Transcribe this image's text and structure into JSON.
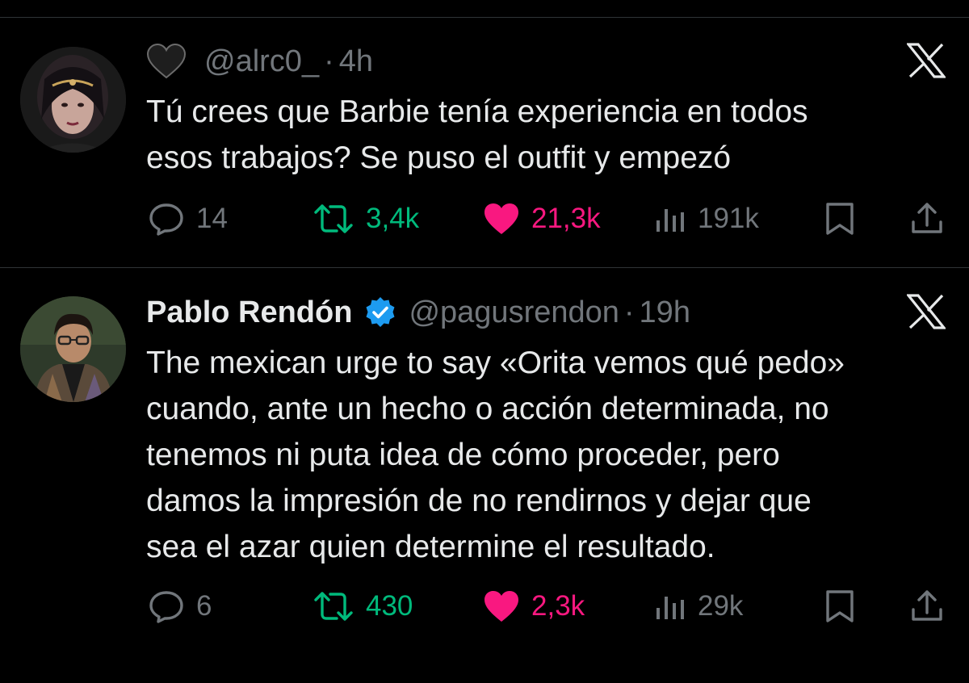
{
  "colors": {
    "background": "#000000",
    "text": "#e7e9ea",
    "muted": "#71767b",
    "retweet": "#00ba7c",
    "like": "#f91880",
    "verified": "#1d9bf0"
  },
  "tweets": [
    {
      "display_name": "",
      "name_emoji": "black-heart-icon",
      "handle": "@alrc0_",
      "separator": "·",
      "time": "4h",
      "verified": false,
      "text_lines": [
        "Tú crees que Barbie tenía experiencia en todos",
        "esos trabajos? Se puso el outfit y empezó"
      ],
      "stats": {
        "replies": "14",
        "retweets": "3,4k",
        "likes": "21,3k",
        "views": "191k"
      },
      "liked": true
    },
    {
      "display_name": "Pablo Rendón",
      "handle": "@pagusrendon",
      "separator": "·",
      "time": "19h",
      "verified": true,
      "text_lines": [
        "The mexican urge to say «Orita vemos qué pedo»",
        "cuando, ante un hecho o acción determinada, no",
        "tenemos ni puta idea de cómo proceder, pero",
        "damos la impresión de no rendirnos y dejar que",
        "sea el azar quien determine el resultado."
      ],
      "stats": {
        "replies": "6",
        "retweets": "430",
        "likes": "2,3k",
        "views": "29k"
      },
      "liked": true
    }
  ]
}
